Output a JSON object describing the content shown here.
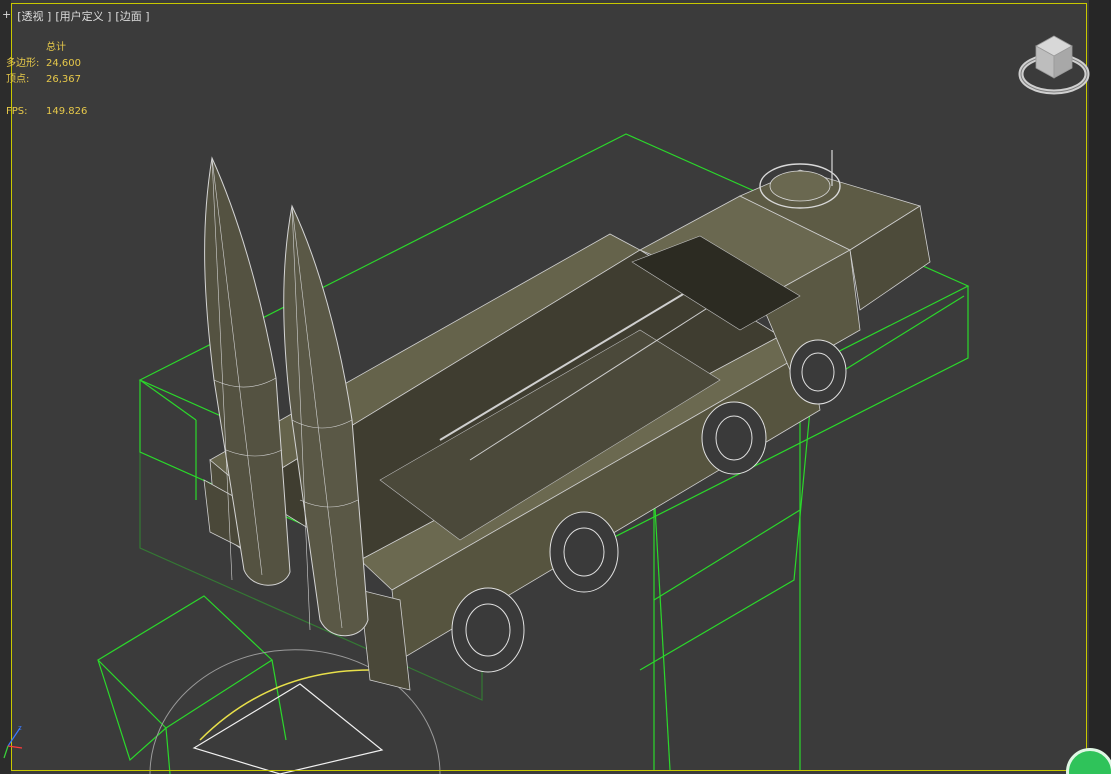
{
  "viewport": {
    "labels": {
      "plus": "+",
      "view": "[透视 ]",
      "shading": "[用户定义 ]",
      "style": "[边面 ]"
    },
    "stats": {
      "header": "总计",
      "polygons_label": "多边形:",
      "polygons_value": "24,600",
      "vertices_label": "顶点:",
      "vertices_value": "26,367",
      "fps_label": "FPS:",
      "fps_value": "149.826"
    }
  },
  "colors": {
    "bounding_box": "#2bd82b",
    "viewport_bg": "#3b3b3b",
    "model": "#5c5a45",
    "wire": "#cfcfcf",
    "stats_text": "#e6c84a",
    "active_border": "#c8c800"
  },
  "icons": {
    "viewcube": "viewcube-icon",
    "axis": "axis-tripod-icon",
    "corner_tool": "green-circle-icon"
  }
}
